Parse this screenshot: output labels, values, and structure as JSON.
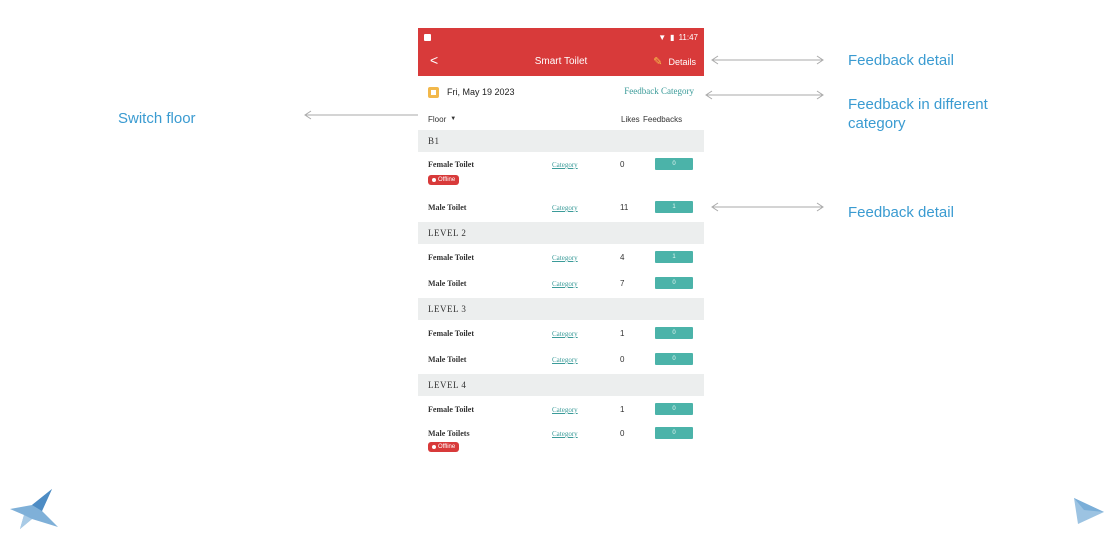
{
  "annotations": {
    "feedback_detail_top": "Feedback detail",
    "feedback_category": "Feedback in different\ncategory",
    "switch_floor": "Switch floor",
    "feedback_detail_row": "Feedback detail"
  },
  "status_bar": {
    "time": "11:47"
  },
  "app_bar": {
    "back": "<",
    "title": "Smart Toilet",
    "details": "Details"
  },
  "date": "Fri, May 19 2023",
  "feedback_category": "Feedback Category",
  "columns": {
    "floor": "Floor",
    "likes": "Likes",
    "feedbacks": "Feedbacks"
  },
  "floors": [
    {
      "name": "B1",
      "rows": [
        {
          "name": "Female Toilet",
          "category": "Category",
          "likes": "0",
          "feedbacks": "0",
          "offline": "Offline"
        },
        {
          "name": "Male Toilet",
          "category": "Category",
          "likes": "11",
          "feedbacks": "1"
        }
      ]
    },
    {
      "name": "LEVEL 2",
      "rows": [
        {
          "name": "Female Toilet",
          "category": "Category",
          "likes": "4",
          "feedbacks": "1"
        },
        {
          "name": "Male Toilet",
          "category": "Category",
          "likes": "7",
          "feedbacks": "0"
        }
      ]
    },
    {
      "name": "LEVEL 3",
      "rows": [
        {
          "name": "Female Toilet",
          "category": "Category",
          "likes": "1",
          "feedbacks": "0"
        },
        {
          "name": "Male Toilet",
          "category": "Category",
          "likes": "0",
          "feedbacks": "0"
        }
      ]
    },
    {
      "name": "LEVEL 4",
      "rows": [
        {
          "name": "Female Toilet",
          "category": "Category",
          "likes": "1",
          "feedbacks": "0"
        },
        {
          "name": "Male Toilets",
          "category": "Category",
          "likes": "0",
          "feedbacks": "0",
          "offline": "Offline"
        }
      ]
    }
  ],
  "colors": {
    "primary": "#d83a3a",
    "accent": "#4bb3a9",
    "link": "#3b9b99",
    "annotation": "#3a9bd1"
  },
  "icons": [
    "back-arrow-icon",
    "edit-icon",
    "calendar-icon",
    "dropdown-icon",
    "wifi-icon",
    "battery-icon"
  ]
}
